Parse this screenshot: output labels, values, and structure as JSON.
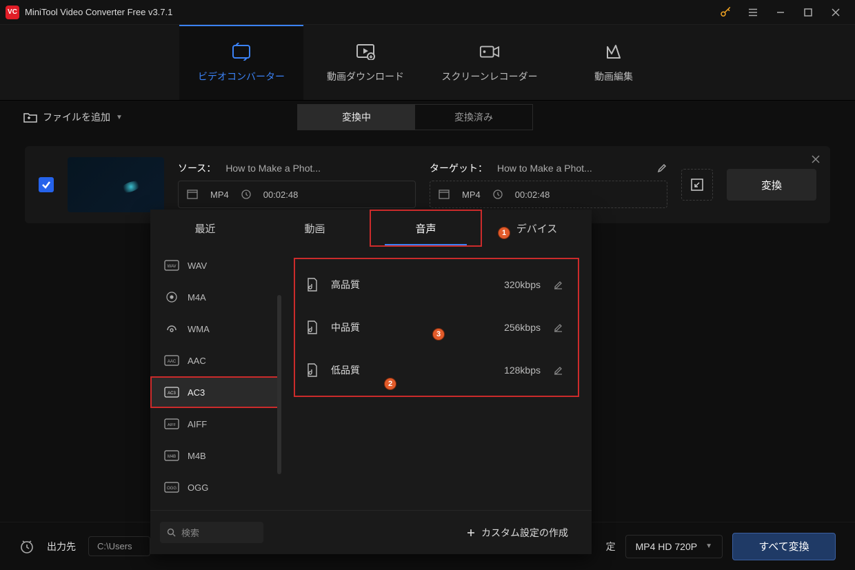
{
  "app": {
    "logo_text": "VC",
    "title": "MiniTool Video Converter Free v3.7.1"
  },
  "mainnav": {
    "converter": "ビデオコンバーター",
    "download": "動画ダウンロード",
    "recorder": "スクリーンレコーダー",
    "editor": "動画編集"
  },
  "actionbar": {
    "add_file": "ファイルを追加",
    "converting": "変換中",
    "converted": "変換済み"
  },
  "task": {
    "source_label": "ソース：",
    "target_label": "ターゲット：",
    "source_title": "How to Make a Phot...",
    "target_title": "How to Make a Phot...",
    "source_format": "MP4",
    "source_duration": "00:02:48",
    "target_format": "MP4",
    "target_duration": "00:02:48",
    "convert": "変換"
  },
  "dropdown": {
    "tabs": {
      "recent": "最近",
      "video": "動画",
      "audio": "音声",
      "device": "デバイス"
    },
    "formats": [
      "WAV",
      "M4A",
      "WMA",
      "AAC",
      "AC3",
      "AIFF",
      "M4B",
      "OGG"
    ],
    "selected_format": "AC3",
    "quality": [
      {
        "name": "高品質",
        "rate": "320kbps"
      },
      {
        "name": "中品質",
        "rate": "256kbps"
      },
      {
        "name": "低品質",
        "rate": "128kbps"
      }
    ],
    "search_placeholder": "検索",
    "custom": "カスタム設定の作成"
  },
  "footer": {
    "output_label": "出力先",
    "path": "C:\\Users",
    "format_trail": "定",
    "format": "MP4 HD 720P",
    "convert_all": "すべて変換"
  },
  "badges": {
    "1": "1",
    "2": "2",
    "3": "3"
  }
}
